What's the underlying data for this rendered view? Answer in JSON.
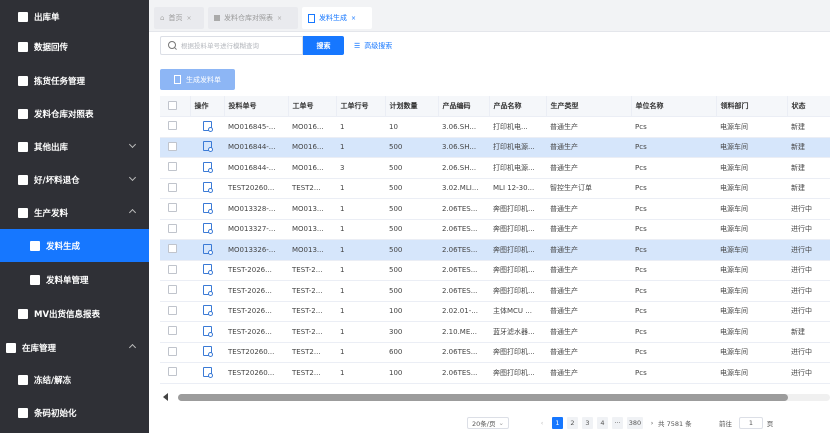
{
  "sidebar": {
    "items": [
      {
        "label": "出库单",
        "icon": "document-icon"
      },
      {
        "label": "数据回传",
        "icon": "transfer-icon"
      },
      {
        "label": "拣货任务管理",
        "icon": "clipboard-icon"
      },
      {
        "label": "发料仓库对照表",
        "icon": "table-icon"
      },
      {
        "label": "其他出库",
        "icon": "box-icon"
      },
      {
        "label": "好/坏料退仓",
        "icon": "box-icon"
      },
      {
        "label": "生产发料",
        "icon": "box-icon"
      },
      {
        "label": "发料生成",
        "icon": "document-edit-icon"
      },
      {
        "label": "发料单管理",
        "icon": "document-icon"
      },
      {
        "label": "MV出货信息报表",
        "icon": "report-icon"
      },
      {
        "label": "在库管理",
        "icon": "warehouse-icon"
      },
      {
        "label": "冻结/解冻",
        "icon": "freeze-icon"
      },
      {
        "label": "条码初始化",
        "icon": "barcode-icon"
      }
    ]
  },
  "tabs": [
    {
      "label": "首页",
      "icon": "home-icon"
    },
    {
      "label": "发料仓库对照表",
      "icon": "table-icon"
    },
    {
      "label": "发料生成",
      "icon": "document-edit-icon"
    }
  ],
  "search": {
    "placeholder": "根据投料单号进行模糊查询",
    "value": "",
    "button_label": "搜索",
    "advanced_label": "高级搜索"
  },
  "toolbar": {
    "generate_label": "生成发料单"
  },
  "table": {
    "columns": [
      "操作",
      "投料单号",
      "工单号",
      "工单行号",
      "计划数量",
      "产品编码",
      "产品名称",
      "生产类型",
      "单位名称",
      "领料部门",
      "状态"
    ],
    "rows": [
      [
        "MO016845-...",
        "MO016...",
        "1",
        "10",
        "3.06.SH...",
        "打印机电...",
        "普通生产",
        "Pcs",
        "电源车间",
        "新建"
      ],
      [
        "MO016844-...",
        "MO016...",
        "1",
        "500",
        "3.06.SH...",
        "打印机电源...",
        "普通生产",
        "Pcs",
        "电源车间",
        "新建"
      ],
      [
        "MO016844-...",
        "MO016...",
        "3",
        "500",
        "2.06.SH...",
        "打印机电源...",
        "普通生产",
        "Pcs",
        "电源车间",
        "新建"
      ],
      [
        "TEST20260...",
        "TEST2...",
        "1",
        "500",
        "3.02.MLI...",
        "MLI 12-30...",
        "智控生产订单",
        "Pcs",
        "电源车间",
        "新建"
      ],
      [
        "MO013328-...",
        "MO013...",
        "1",
        "500",
        "2.06TES...",
        "奔图打印机...",
        "普通生产",
        "Pcs",
        "电源车间",
        "进行中"
      ],
      [
        "MO013327-...",
        "MO013...",
        "1",
        "500",
        "2.06TES...",
        "奔图打印机...",
        "普通生产",
        "Pcs",
        "电源车间",
        "进行中"
      ],
      [
        "MO013326-...",
        "MO013...",
        "1",
        "500",
        "2.06TES...",
        "奔图打印机...",
        "普通生产",
        "Pcs",
        "电源车间",
        "进行中"
      ],
      [
        "TEST-2026...",
        "TEST-2...",
        "1",
        "500",
        "2.06TES...",
        "奔图打印机...",
        "普通生产",
        "Pcs",
        "电源车间",
        "进行中"
      ],
      [
        "TEST-2026...",
        "TEST-2...",
        "1",
        "500",
        "2.06TES...",
        "奔图打印机...",
        "普通生产",
        "Pcs",
        "电源车间",
        "进行中"
      ],
      [
        "TEST-2026...",
        "TEST-2...",
        "1",
        "100",
        "2.02.01-...",
        "主体MCU ...",
        "普通生产",
        "Pcs",
        "电源车间",
        "进行中"
      ],
      [
        "TEST-2026...",
        "TEST-2...",
        "1",
        "300",
        "2.10.ME...",
        "蓝牙滤水器...",
        "普通生产",
        "Pcs",
        "电源车间",
        "新建"
      ],
      [
        "TEST20260...",
        "TEST2...",
        "1",
        "600",
        "2.06TES...",
        "奔图打印机...",
        "普通生产",
        "Pcs",
        "电源车间",
        "进行中"
      ],
      [
        "TEST20260...",
        "TEST2...",
        "1",
        "100",
        "2.06TES...",
        "奔图打印机...",
        "普通生产",
        "Pcs",
        "电源车间",
        "进行中"
      ]
    ],
    "selected_rows": [
      1,
      6
    ]
  },
  "pagination": {
    "page_size": "20条/页",
    "pages": [
      "1",
      "2",
      "3",
      "4",
      "380"
    ],
    "ellipsis": "···",
    "current": "1",
    "total": "共 7581 条",
    "goto_label": "前往",
    "goto_value": "1",
    "page_unit": "页"
  },
  "colors": {
    "accent": "#1677ff",
    "sidebar_bg": "#2f3036",
    "selected_row": "#d6e6fb"
  }
}
